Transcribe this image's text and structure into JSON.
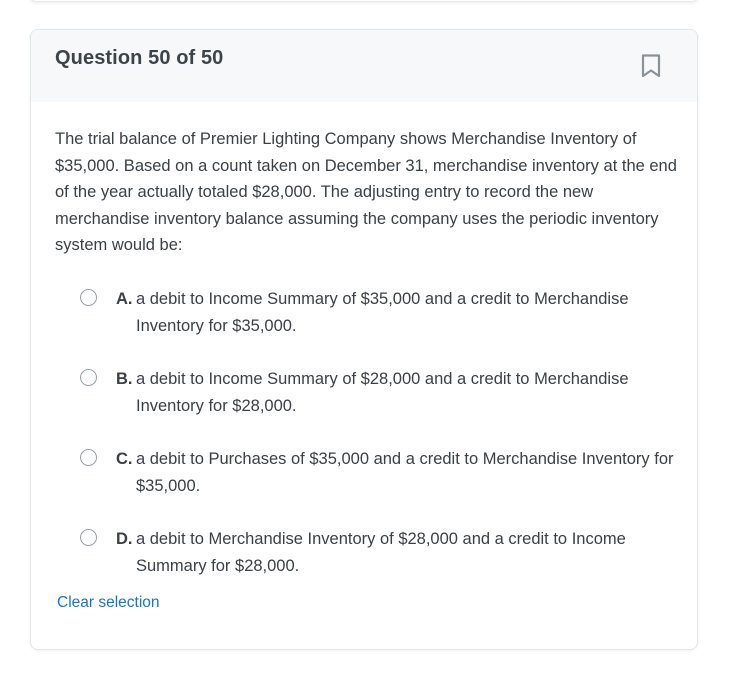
{
  "question": {
    "title": "Question 50 of 50",
    "stem": "The trial balance of Premier Lighting Company shows Merchandise Inventory of $35,000. Based on a count taken on December 31, merchandise inventory at the end of the year actually totaled $28,000. The adjusting entry to record the new merchandise inventory balance assuming the company uses the periodic inventory system would be:",
    "options": [
      {
        "letter": "A.",
        "text": "a debit to Income Summary of $35,000 and a credit to Merchandise Inventory for $35,000."
      },
      {
        "letter": "B.",
        "text": "a debit to Income Summary of $28,000 and a credit to Merchandise Inventory for $28,000."
      },
      {
        "letter": "C.",
        "text": "a debit to Purchases of $35,000 and a credit to Merchandise Inventory for $35,000."
      },
      {
        "letter": "D.",
        "text": "a debit to Merchandise Inventory of $28,000 and a credit to Income Summary for $28,000."
      }
    ],
    "clear_label": "Clear selection"
  },
  "icons": {
    "bookmark": "bookmark-icon",
    "radio": "radio-unselected"
  },
  "colors": {
    "header_bg": "#f7f8f9",
    "link": "#1a73c7",
    "text": "#3b4045",
    "icon": "#8a9198"
  }
}
